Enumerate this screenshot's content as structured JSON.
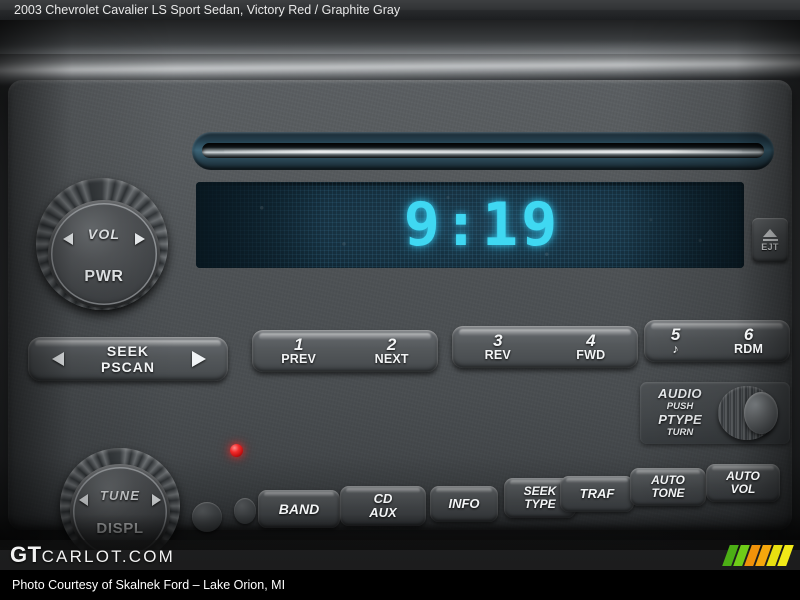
{
  "titlebar": {
    "year_make_model": "2003 Chevrolet Cavalier LS Sport Sedan,",
    "colors": "Victory Red / Graphite Gray"
  },
  "radio": {
    "display": {
      "clock": "9:19",
      "glow_color": "#3fd8f2",
      "background_color": "#16303f"
    },
    "eject_button": {
      "label": "EJT",
      "icon": "eject-icon"
    },
    "volume_knob": {
      "top_label": "VOL",
      "bottom_label": "PWR"
    },
    "tune_knob": {
      "top_label": "TUNE",
      "bottom_label": "DISPL"
    },
    "seek_button": {
      "line1": "SEEK",
      "line2": "PSCAN"
    },
    "audio_knob": {
      "line1": "AUDIO",
      "line2": "PUSH",
      "line3": "PTYPE",
      "line4": "TURN"
    },
    "presets": [
      {
        "number": "1",
        "sub": "PREV"
      },
      {
        "number": "2",
        "sub": "NEXT"
      },
      {
        "number": "3",
        "sub": "REV"
      },
      {
        "number": "4",
        "sub": "FWD"
      },
      {
        "number": "5",
        "sub": "♪"
      },
      {
        "number": "6",
        "sub": "RDM"
      }
    ],
    "function_buttons": [
      {
        "id": "band",
        "line1": "BAND",
        "line2": ""
      },
      {
        "id": "cd-aux",
        "line1": "CD",
        "line2": "AUX"
      },
      {
        "id": "info",
        "line1": "INFO",
        "line2": ""
      },
      {
        "id": "seek-type",
        "line1": "SEEK",
        "line2": "TYPE"
      },
      {
        "id": "traf",
        "line1": "TRAF",
        "line2": ""
      },
      {
        "id": "auto-tone",
        "line1": "AUTO",
        "line2": "TONE"
      },
      {
        "id": "auto-vol",
        "line1": "AUTO",
        "line2": "VOL"
      }
    ]
  },
  "watermark": {
    "brand_bold": "GT",
    "brand_rest": "CARLOT.COM",
    "stripe_colors": [
      "#4caf15",
      "#6fcc18",
      "#f0920a",
      "#f5a70c",
      "#e8e010",
      "#f2ea18"
    ]
  },
  "footer": {
    "credit": "Photo Courtesy of Skalnek Ford – Lake Orion, MI"
  }
}
